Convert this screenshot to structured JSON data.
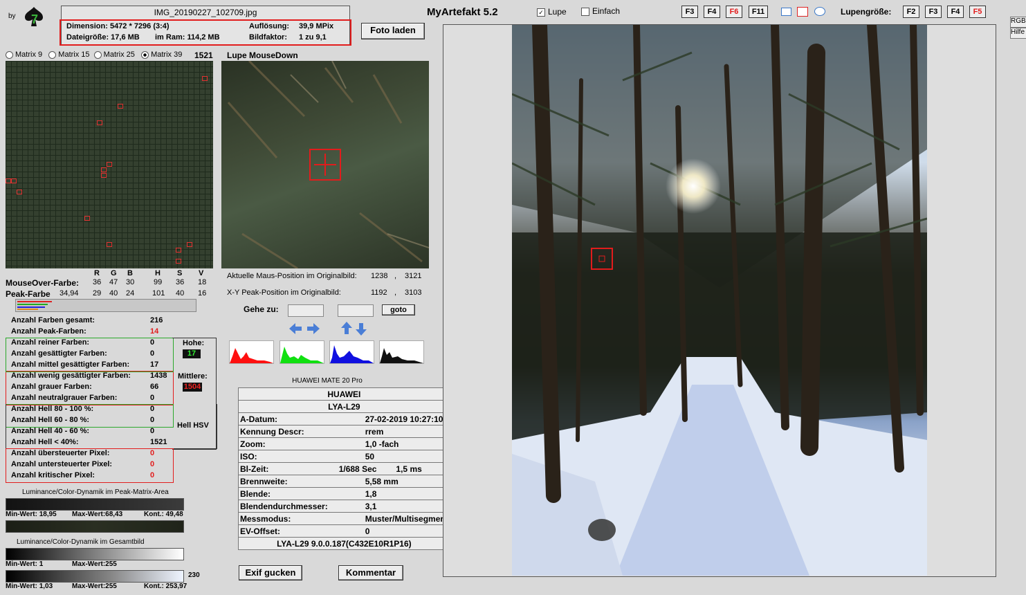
{
  "logo": {
    "by": "by",
    "digit": "7"
  },
  "file": {
    "name": "IMG_20190227_102709.jpg",
    "dimension": "Dimension: 5472 * 7296 (3:4)",
    "aufloesung_label": "Auflösung:",
    "aufloesung": "39,9 MPix",
    "dateigroesse": "Dateigröße: 17,6 MB",
    "im_ram": "im Ram: 114,2 MB",
    "bildfaktor_label": "Bildfaktor:",
    "bildfaktor": "1 zu 9,1"
  },
  "buttons": {
    "foto_laden": "Foto laden",
    "goto": "goto",
    "exif": "Exif gucken",
    "kommentar": "Kommentar"
  },
  "app_title": "MyArtefakt 5.2",
  "checks": {
    "lupe": "Lupe",
    "einfach": "Einfach"
  },
  "fkeys_left": [
    "F3",
    "F4",
    "F6",
    "F11"
  ],
  "fkeys_right": [
    "F2",
    "F3",
    "F4",
    "F5"
  ],
  "lupengroesse": "Lupengröße:",
  "side_tabs": [
    "RGB",
    "Hilfe"
  ],
  "matrix": {
    "options": [
      "Matrix 9",
      "Matrix 15",
      "Matrix 25",
      "Matrix 39"
    ],
    "selected": "Matrix 39",
    "count": "1521"
  },
  "lupe_title": "Lupe MouseDown",
  "colors": {
    "headers": [
      "R",
      "G",
      "B",
      "H",
      "S",
      "V"
    ],
    "mouseover_label": "MouseOver-Farbe:",
    "mouseover": [
      "36",
      "47",
      "30",
      "99",
      "36",
      "18"
    ],
    "peak_label": "Peak-Farbe",
    "peak_extra": "34,94",
    "peak": [
      "29",
      "40",
      "24",
      "101",
      "40",
      "16"
    ]
  },
  "positions": {
    "maus_label": "Aktuelle Maus-Position  im Originalbild:",
    "maus_x": "1238",
    "maus_y": "3121",
    "peak_label": "X-Y Peak-Position  im Originalbild:",
    "peak_x": "1192",
    "peak_y": "3103",
    "sep": ","
  },
  "gehe_zu": "Gehe zu:",
  "stats": [
    {
      "label": "Anzahl Farben gesamt:",
      "value": "216",
      "red": false
    },
    {
      "label": "Anzahl Peak-Farben:",
      "value": "14",
      "red": true
    },
    {
      "label": "Anzahl reiner Farben:",
      "value": "0",
      "red": false
    },
    {
      "label": "Anzahl gesättigter Farben:",
      "value": "0",
      "red": false
    },
    {
      "label": "Anzahl mittel gesättigter Farben:",
      "value": "17",
      "red": false
    },
    {
      "label": "Anzahl wenig gesättigter Farben:",
      "value": "1438",
      "red": false
    },
    {
      "label": "Anzahl grauer Farben:",
      "value": "66",
      "red": false
    },
    {
      "label": "Anzahl neutralgrauer Farben:",
      "value": "0",
      "red": false
    },
    {
      "label": "Anzahl Hell 80 - 100 %:",
      "value": "0",
      "red": false
    },
    {
      "label": "Anzahl Hell 60 - 80 %:",
      "value": "0",
      "red": false
    },
    {
      "label": "Anzahl Hell 40 - 60 %:",
      "value": "0",
      "red": false
    },
    {
      "label": "Anzahl Hell < 40%:",
      "value": "1521",
      "red": false
    },
    {
      "label": "Anzahl übersteuerter Pixel:",
      "value": "0",
      "red": true
    },
    {
      "label": "Anzahl untersteuerter Pixel:",
      "value": "0",
      "red": true
    },
    {
      "label": "Anzahl kritischer Pixel:",
      "value": "0",
      "red": true
    }
  ],
  "side_labels": {
    "hoehe": "Hohe:",
    "hoehe_val": "17",
    "mittlere": "Mittlere:",
    "mittlere_val": "1504",
    "hell_hsv": "Hell HSV"
  },
  "dynamik": {
    "peak_title": "Luminance/Color-Dynamik im Peak-Matrix-Area",
    "peak_min": "Min-Wert: 18,95",
    "peak_max": "Max-Wert:68,43",
    "peak_kont": "Kont.: 49,48",
    "gesamt_title": "Luminance/Color-Dynamik im Gesamtbild",
    "ges_min1": "Min-Wert: 1",
    "ges_max1": "Max-Wert:255",
    "ges_side": "230",
    "ges_min2": "Min-Wert: 1,03",
    "ges_max2": "Max-Wert:255",
    "ges_kont": "Kont.: 253,97"
  },
  "camera_header": "HUAWEI MATE 20 Pro",
  "exif": [
    {
      "label": "",
      "value": "HUAWEI"
    },
    {
      "label": "",
      "value": "LYA-L29"
    },
    {
      "label": "A-Datum:",
      "value": "27-02-2019 10:27:10"
    },
    {
      "label": "Kennung Descr:",
      "value": "rrem"
    },
    {
      "label": "Zoom:",
      "value": "1,0 -fach"
    },
    {
      "label": "ISO:",
      "value": "50"
    },
    {
      "label": "Bl-Zeit:",
      "value": "1/688 Sec",
      "value2": "1,5 ms"
    },
    {
      "label": "Brennweite:",
      "value": "5,58  mm"
    },
    {
      "label": "Blende:",
      "value": "1,8"
    },
    {
      "label": "Blendendurchmesser:",
      "value": "3,1"
    },
    {
      "label": "Messmodus:",
      "value": "Muster/Multisegment"
    },
    {
      "label": "EV-Offset:",
      "value": "0"
    },
    {
      "label": "",
      "value": "LYA-L29 9.0.0.187(C432E10R1P16)"
    }
  ]
}
